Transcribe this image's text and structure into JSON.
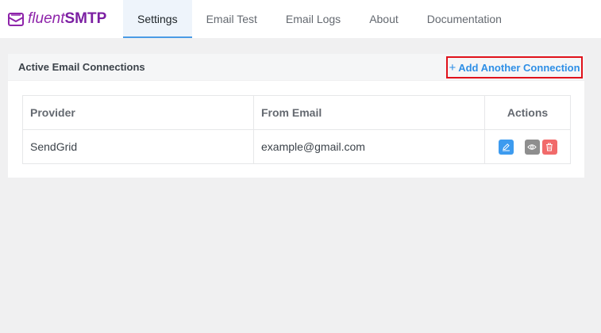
{
  "brand": {
    "name_part1": "fluent",
    "name_part2": "SMTP",
    "icon": "envelope-logo-icon",
    "color": "#7b1fa2"
  },
  "nav": {
    "tabs": [
      {
        "label": "Settings",
        "active": true
      },
      {
        "label": "Email Test",
        "active": false
      },
      {
        "label": "Email Logs",
        "active": false
      },
      {
        "label": "About",
        "active": false
      },
      {
        "label": "Documentation",
        "active": false
      }
    ],
    "active_color": "#4a9be5"
  },
  "panel": {
    "title": "Active Email Connections",
    "add_button": {
      "label": "Add Another Connection",
      "icon": "plus-icon",
      "color": "#2e8fe6",
      "highlight_color": "#e0121b"
    }
  },
  "table": {
    "headers": [
      "Provider",
      "From Email",
      "Actions"
    ],
    "rows": [
      {
        "provider": "SendGrid",
        "from_email": "example@gmail.com",
        "actions": [
          {
            "icon": "edit-pencil-icon",
            "color": "#3d9bef"
          },
          {
            "icon": "eye-icon",
            "color": "#8e8e8e"
          },
          {
            "icon": "trash-icon",
            "color": "#f16a6a"
          }
        ]
      }
    ]
  }
}
